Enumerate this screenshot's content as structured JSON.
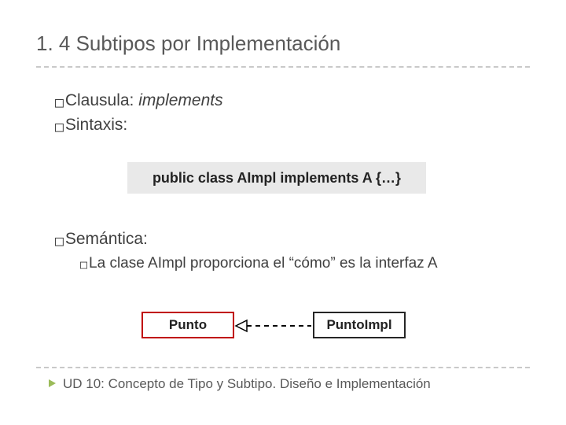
{
  "title": "1. 4 Subtipos por Implementación",
  "bullets": {
    "clausula_label": "Clausula:",
    "clausula_value": "implements",
    "sintaxis_label": "Sintaxis:",
    "semantica_label": "Semántica:",
    "semantica_sub_prefix": "La",
    "semantica_sub_rest": " clase AImpl proporciona el “cómo” es la interfaz A"
  },
  "code": {
    "prefix": "public class AImpl ",
    "keyword": "implements",
    "suffix": " A {…}"
  },
  "uml": {
    "left_box": "Punto",
    "right_box": "PuntoImpl"
  },
  "footer": {
    "text": "UD 10: Concepto de Tipo y Subtipo. Diseño e Implementación"
  }
}
